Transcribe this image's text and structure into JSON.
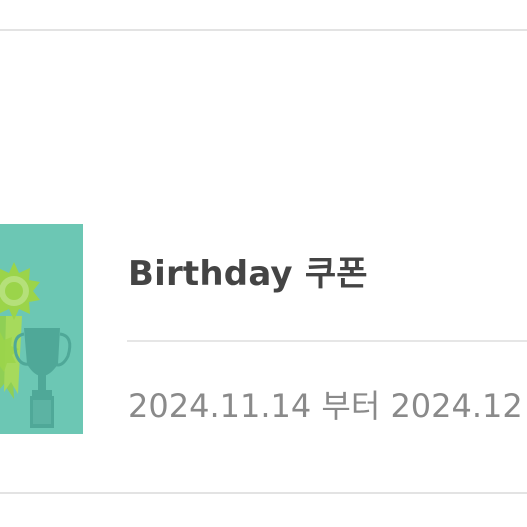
{
  "coupon": {
    "title": "Birthday 쿠폰",
    "period": "2024.11.14 부터 2024.12",
    "thumbnail_icons": [
      "rosette-ribbon-icon",
      "trophy-icon"
    ],
    "colors": {
      "thumbnail_bg": "#6cc7b4",
      "rosette": "#9bd44a",
      "trophy": "#4fa898",
      "title": "#444444",
      "period": "#8a8a8a",
      "divider": "#e3e3e3"
    }
  }
}
